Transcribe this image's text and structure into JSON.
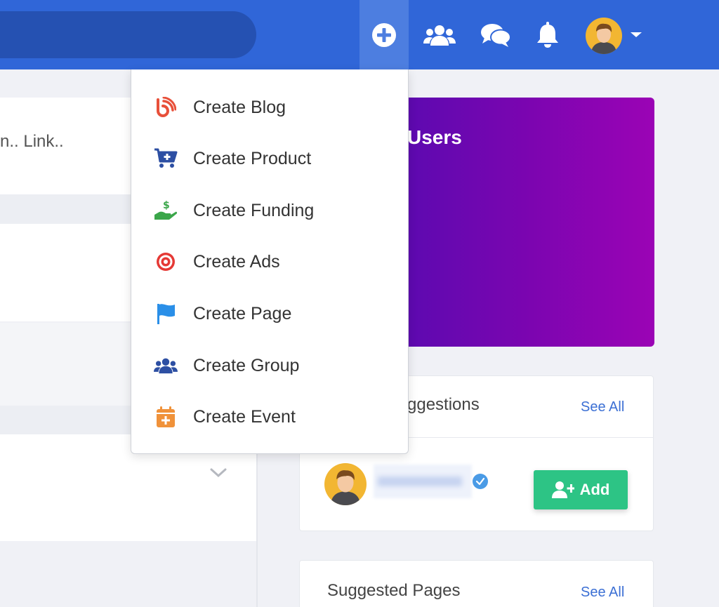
{
  "header": {
    "search_placeholder": "",
    "icons": [
      "plus-circle-icon",
      "users-icon",
      "chat-icon",
      "bell-icon"
    ],
    "accent_color": "#3066d8"
  },
  "feed": {
    "composer_hint": "n.. Link.."
  },
  "promo": {
    "title": "Users"
  },
  "suggestions": {
    "title": "ggestions",
    "see_all": "See All",
    "add_label": "Add"
  },
  "suggested_pages": {
    "title": "Suggested Pages",
    "see_all": "See All"
  },
  "create_menu": {
    "items": [
      {
        "label": "Create Blog",
        "icon": "blog-rss-icon",
        "color": "#e8503a"
      },
      {
        "label": "Create Product",
        "icon": "cart-plus-icon",
        "color": "#2d4fa3"
      },
      {
        "label": "Create Funding",
        "icon": "hand-dollar-icon",
        "color": "#3ba64a"
      },
      {
        "label": "Create Ads",
        "icon": "target-icon",
        "color": "#e53935"
      },
      {
        "label": "Create Page",
        "icon": "flag-icon",
        "color": "#2a8fe8"
      },
      {
        "label": "Create Group",
        "icon": "group-icon",
        "color": "#2d4fa3"
      },
      {
        "label": "Create Event",
        "icon": "calendar-plus-icon",
        "color": "#f0923a"
      }
    ]
  }
}
